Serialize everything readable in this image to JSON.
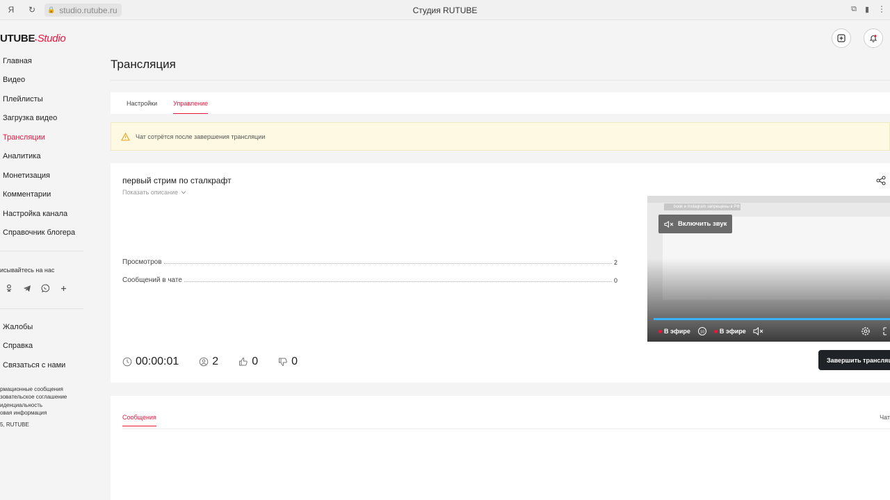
{
  "browser": {
    "url": "studio.rutube.ru",
    "window_title": "Студия RUTUBE"
  },
  "logo": {
    "rutube": "UTUBE",
    "studio": "Studio"
  },
  "sidebar": {
    "items": [
      {
        "label": "Главная"
      },
      {
        "label": "Видео"
      },
      {
        "label": "Плейлисты"
      },
      {
        "label": "Загрузка видео"
      },
      {
        "label": "Трансляции"
      },
      {
        "label": "Аналитика"
      },
      {
        "label": "Монетизация"
      },
      {
        "label": "Комментарии"
      },
      {
        "label": "Настройка канала"
      },
      {
        "label": "Справочник блогера"
      }
    ],
    "social_title": "исывайтесь на нас",
    "bottom_items": [
      {
        "label": "Жалобы"
      },
      {
        "label": "Справка"
      },
      {
        "label": "Связаться с нами"
      }
    ],
    "footer_links": [
      "рмационные сообщения",
      "зовательское соглашение",
      "иденциальность",
      "овая информация"
    ],
    "copyright": "5, RUTUBE"
  },
  "page": {
    "title": "Трансляция",
    "tabs": [
      {
        "label": "Настройки"
      },
      {
        "label": "Управление"
      }
    ],
    "warning": "Чат сотрётся после завершения трансляции"
  },
  "stream": {
    "title": "первый стрим по сталкрафт",
    "show_description": "Показать описание",
    "stats": [
      {
        "label": "Просмотров",
        "value": "2"
      },
      {
        "label": "Сообщений в чате",
        "value": "0"
      }
    ],
    "duration": "00:00:01",
    "viewers": "2",
    "likes": "0",
    "dislikes": "0",
    "end_button": "Завершить трансляцию"
  },
  "player": {
    "top_banner": "book и Instagram запрещены в РФ",
    "unmute_label": "Включить звук",
    "live_label": "В эфире",
    "live_label_2": "В эфире",
    "skip_label": "10"
  },
  "messages": {
    "tab": "Сообщения",
    "chat_label": "Чат"
  },
  "colors": {
    "accent": "#ed143d",
    "warning_bg": "#fdf9e2",
    "progress": "#3bb2ff"
  }
}
